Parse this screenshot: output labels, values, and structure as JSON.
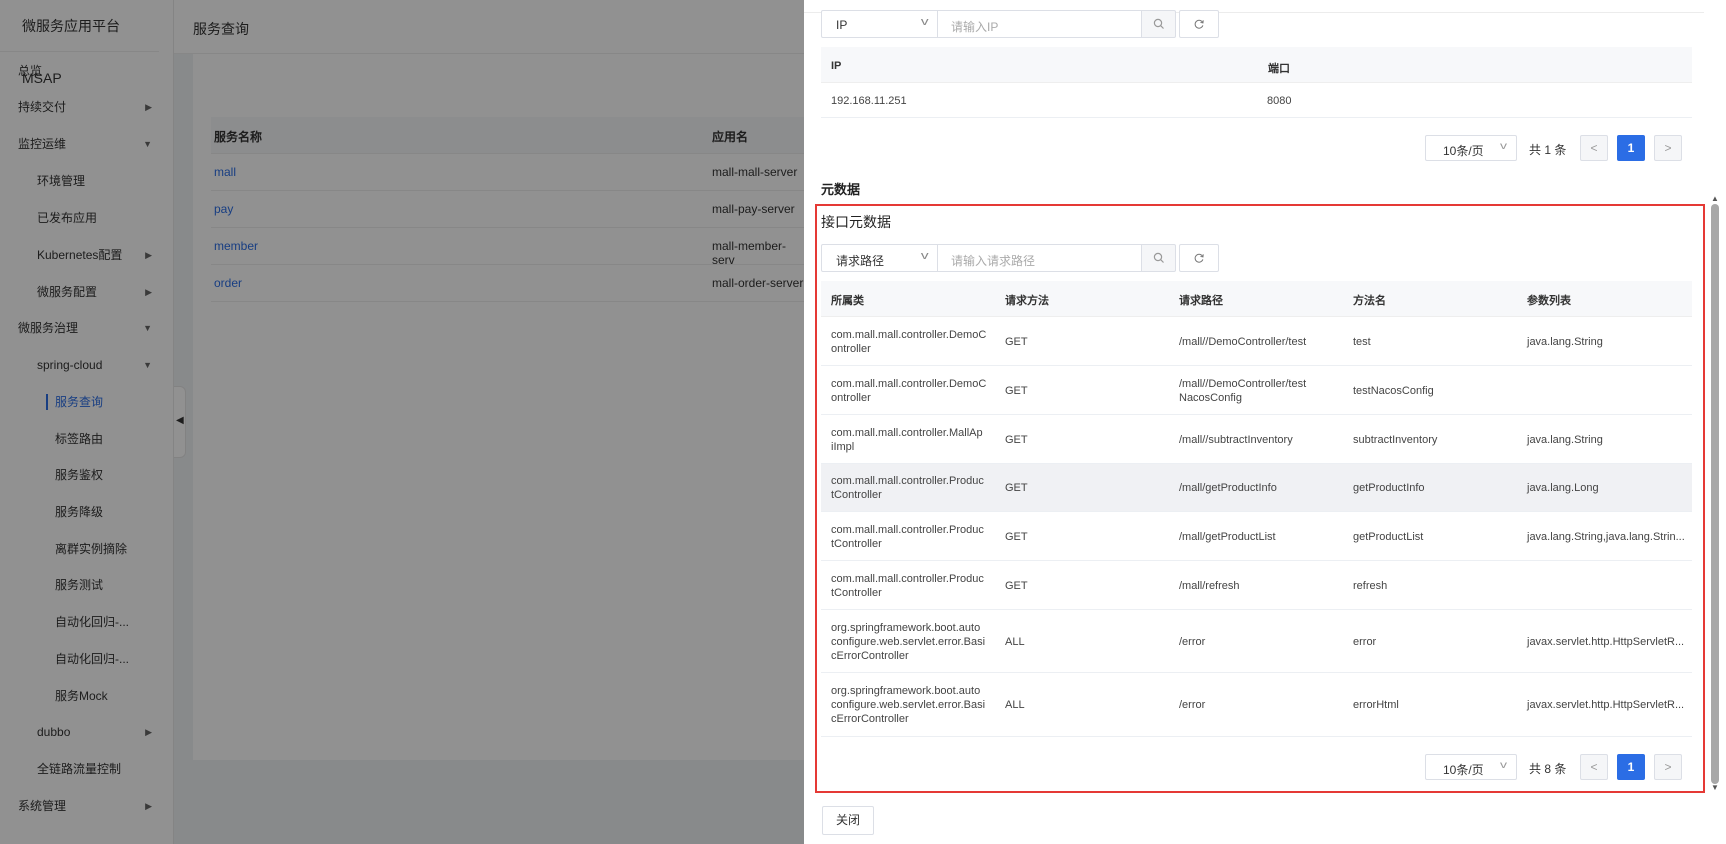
{
  "sidebar": {
    "brand": "微服务应用平台MSAP",
    "items": [
      {
        "label": "总览",
        "indent": 0,
        "caret": ""
      },
      {
        "label": "持续交付",
        "indent": 0,
        "caret": "▶"
      },
      {
        "label": "监控运维",
        "indent": 0,
        "caret": "▼"
      },
      {
        "label": "环境管理",
        "indent": 1,
        "caret": ""
      },
      {
        "label": "已发布应用",
        "indent": 1,
        "caret": ""
      },
      {
        "label": "Kubernetes配置",
        "indent": 1,
        "caret": "▶"
      },
      {
        "label": "微服务配置",
        "indent": 1,
        "caret": "▶"
      },
      {
        "label": "微服务治理",
        "indent": 0,
        "caret": "▼"
      },
      {
        "label": "spring-cloud",
        "indent": 1,
        "caret": "▼"
      },
      {
        "label": "服务查询",
        "indent": 2,
        "caret": "",
        "active": true
      },
      {
        "label": "标签路由",
        "indent": 2,
        "caret": ""
      },
      {
        "label": "服务鉴权",
        "indent": 2,
        "caret": ""
      },
      {
        "label": "服务降级",
        "indent": 2,
        "caret": ""
      },
      {
        "label": "离群实例摘除",
        "indent": 2,
        "caret": ""
      },
      {
        "label": "服务测试",
        "indent": 2,
        "caret": ""
      },
      {
        "label": "自动化回归-...",
        "indent": 2,
        "caret": ""
      },
      {
        "label": "自动化回归-...",
        "indent": 2,
        "caret": ""
      },
      {
        "label": "服务Mock",
        "indent": 2,
        "caret": ""
      },
      {
        "label": "dubbo",
        "indent": 1,
        "caret": "▶"
      },
      {
        "label": "全链路流量控制",
        "indent": 1,
        "caret": ""
      },
      {
        "label": "系统管理",
        "indent": 0,
        "caret": "▶"
      }
    ]
  },
  "main": {
    "title": "服务查询",
    "table": {
      "headers": [
        "服务名称",
        "应用名"
      ],
      "rows": [
        [
          "mall",
          "mall-mall-server"
        ],
        [
          "pay",
          "mall-pay-server"
        ],
        [
          "member",
          "mall-member-serv"
        ],
        [
          "order",
          "mall-order-server"
        ]
      ]
    }
  },
  "drawer": {
    "ip_filter": {
      "select": "IP",
      "placeholder": "请输入IP"
    },
    "ip_table": {
      "headers": [
        "IP",
        "端口"
      ],
      "rows": [
        [
          "192.168.11.251",
          "8080"
        ]
      ]
    },
    "ip_pager": {
      "size": "10条/页",
      "total": "共 1 条",
      "page": "1",
      "prev": "<",
      "next": ">"
    },
    "meta_title": "元数据",
    "api_title": "接口元数据",
    "api_filter": {
      "select": "请求路径",
      "placeholder": "请输入请求路径"
    },
    "api_table": {
      "headers": [
        "所属类",
        "请求方法",
        "请求路径",
        "方法名",
        "参数列表"
      ],
      "rows": [
        {
          "cls": [
            "com.mall.mall.controller.DemoC",
            "ontroller"
          ],
          "method": "GET",
          "path": [
            "/mall//DemoController/test"
          ],
          "name": "test",
          "params": "java.lang.String"
        },
        {
          "cls": [
            "com.mall.mall.controller.DemoC",
            "ontroller"
          ],
          "method": "GET",
          "path": [
            "/mall//DemoController/test",
            "NacosConfig"
          ],
          "name": "testNacosConfig",
          "params": ""
        },
        {
          "cls": [
            "com.mall.mall.controller.MallAp",
            "iImpl"
          ],
          "method": "GET",
          "path": [
            "/mall//subtractInventory"
          ],
          "name": "subtractInventory",
          "params": "java.lang.String"
        },
        {
          "cls": [
            "com.mall.mall.controller.Produc",
            "tController"
          ],
          "method": "GET",
          "path": [
            "/mall/getProductInfo"
          ],
          "name": "getProductInfo",
          "params": "java.lang.Long"
        },
        {
          "cls": [
            "com.mall.mall.controller.Produc",
            "tController"
          ],
          "method": "GET",
          "path": [
            "/mall/getProductList"
          ],
          "name": "getProductList",
          "params": "java.lang.String,java.lang.Strin..."
        },
        {
          "cls": [
            "com.mall.mall.controller.Produc",
            "tController"
          ],
          "method": "GET",
          "path": [
            "/mall/refresh"
          ],
          "name": "refresh",
          "params": ""
        },
        {
          "cls": [
            "org.springframework.boot.auto",
            "configure.web.servlet.error.Basi",
            "cErrorController"
          ],
          "method": "ALL",
          "path": [
            "/error"
          ],
          "name": "error",
          "params": "javax.servlet.http.HttpServletR..."
        },
        {
          "cls": [
            "org.springframework.boot.auto",
            "configure.web.servlet.error.Basi",
            "cErrorController"
          ],
          "method": "ALL",
          "path": [
            "/error"
          ],
          "name": "errorHtml",
          "params": "javax.servlet.http.HttpServletR..."
        }
      ]
    },
    "api_pager": {
      "size": "10条/页",
      "total": "共 8 条",
      "page": "1",
      "prev": "<",
      "next": ">"
    },
    "close_label": "关闭"
  },
  "colors": {
    "accent": "#2b6de5",
    "highlight": "#e53935"
  }
}
